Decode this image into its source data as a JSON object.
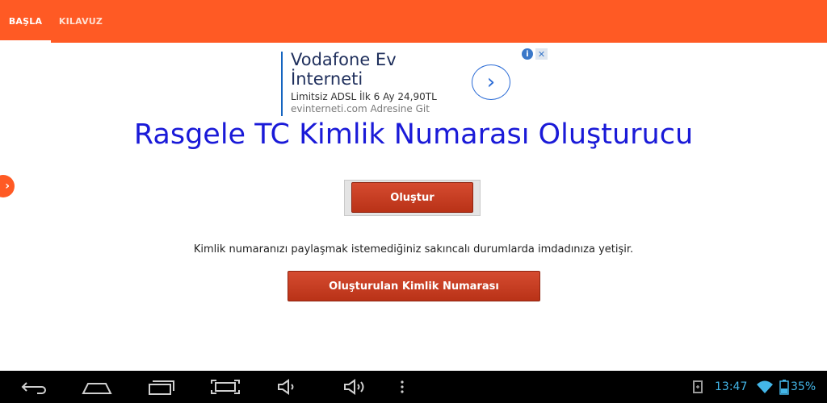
{
  "tabs": [
    {
      "label": "BAŞLA",
      "active": true
    },
    {
      "label": "KILAVUZ",
      "active": false
    }
  ],
  "ad": {
    "title": "Vodafone Ev İnterneti",
    "description": "Limitsiz ADSL İlk 6 Ay 24,90TL",
    "source": "evinterneti.com Adresine Git",
    "info_icon": "info-icon",
    "close_icon": "close-icon"
  },
  "main": {
    "headline": "Rasgele TC Kimlik Numarası Oluşturucu",
    "generate_label": "Oluştur",
    "info": "Kimlik numaranızı paylaşmak istemediğiniz sakıncalı durumlarda imdadınıza yetişir.",
    "generated_label": "Oluşturulan Kimlik Numarası"
  },
  "status_bar": {
    "time": "13:47",
    "battery": "35%"
  },
  "colors": {
    "accent": "#ff5a24",
    "headline": "#1a1ad8",
    "button": "#c63d22",
    "status": "#43b6e8"
  }
}
